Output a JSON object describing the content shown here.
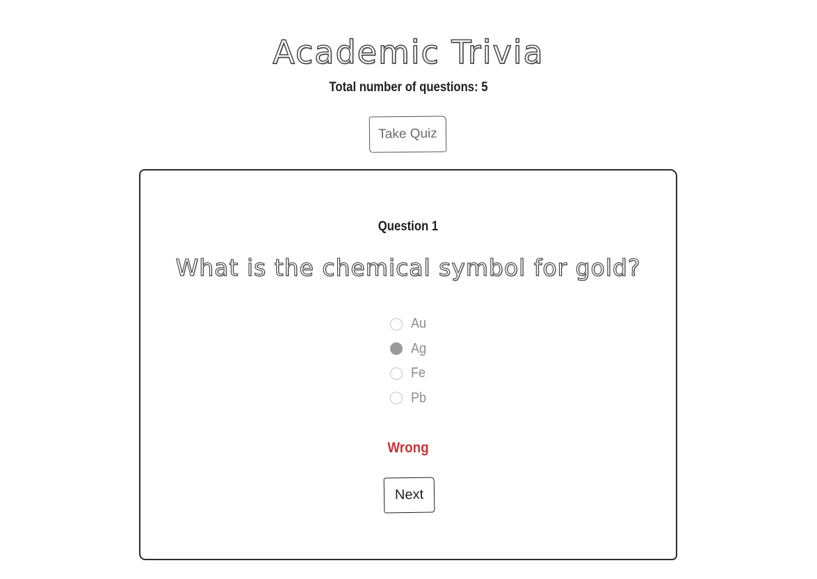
{
  "app": {
    "title": "Academic Trivia",
    "total_questions_text": "Total number of questions: 5",
    "take_quiz_label": "Take Quiz"
  },
  "quiz": {
    "question_number_label": "Question 1",
    "question_text": "What is the chemical symbol for gold?",
    "options": [
      {
        "label": "Au",
        "selected": false
      },
      {
        "label": "Ag",
        "selected": true
      },
      {
        "label": "Fe",
        "selected": false
      },
      {
        "label": "Pb",
        "selected": false
      }
    ],
    "result_text": "Wrong",
    "next_label": "Next"
  },
  "colors": {
    "result_wrong": "#c2373a",
    "selected_radio": "#9a9a9a",
    "option_text": "#8c8c8c"
  }
}
